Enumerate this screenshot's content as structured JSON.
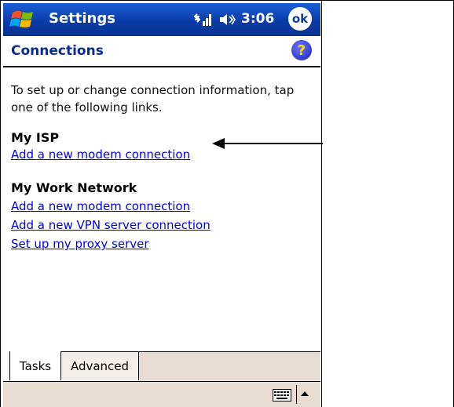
{
  "titlebar": {
    "app_title": "Settings",
    "clock": "3:06",
    "ok_label": "ok"
  },
  "page": {
    "title": "Connections",
    "help_symbol": "?",
    "intro": "To set up or change connection information, tap one of the following links."
  },
  "sections": [
    {
      "heading": "My ISP",
      "links": [
        "Add a new modem connection"
      ]
    },
    {
      "heading": "My Work Network",
      "links": [
        "Add a new modem connection",
        "Add a new VPN server connection",
        "Set up my proxy server"
      ]
    }
  ],
  "tabs": [
    "Tasks",
    "Advanced"
  ],
  "icons": {
    "start": "windows-flag-icon",
    "connectivity": "connectivity-icon",
    "volume": "speaker-icon",
    "help": "help-icon",
    "keyboard": "keyboard-icon",
    "sip": "sip-arrow-icon"
  },
  "colors": {
    "titlebar": "#0a3ca8",
    "heading": "#0a2c8f",
    "link": "#0000ee",
    "bottom_bar": "#e7dcd2"
  }
}
